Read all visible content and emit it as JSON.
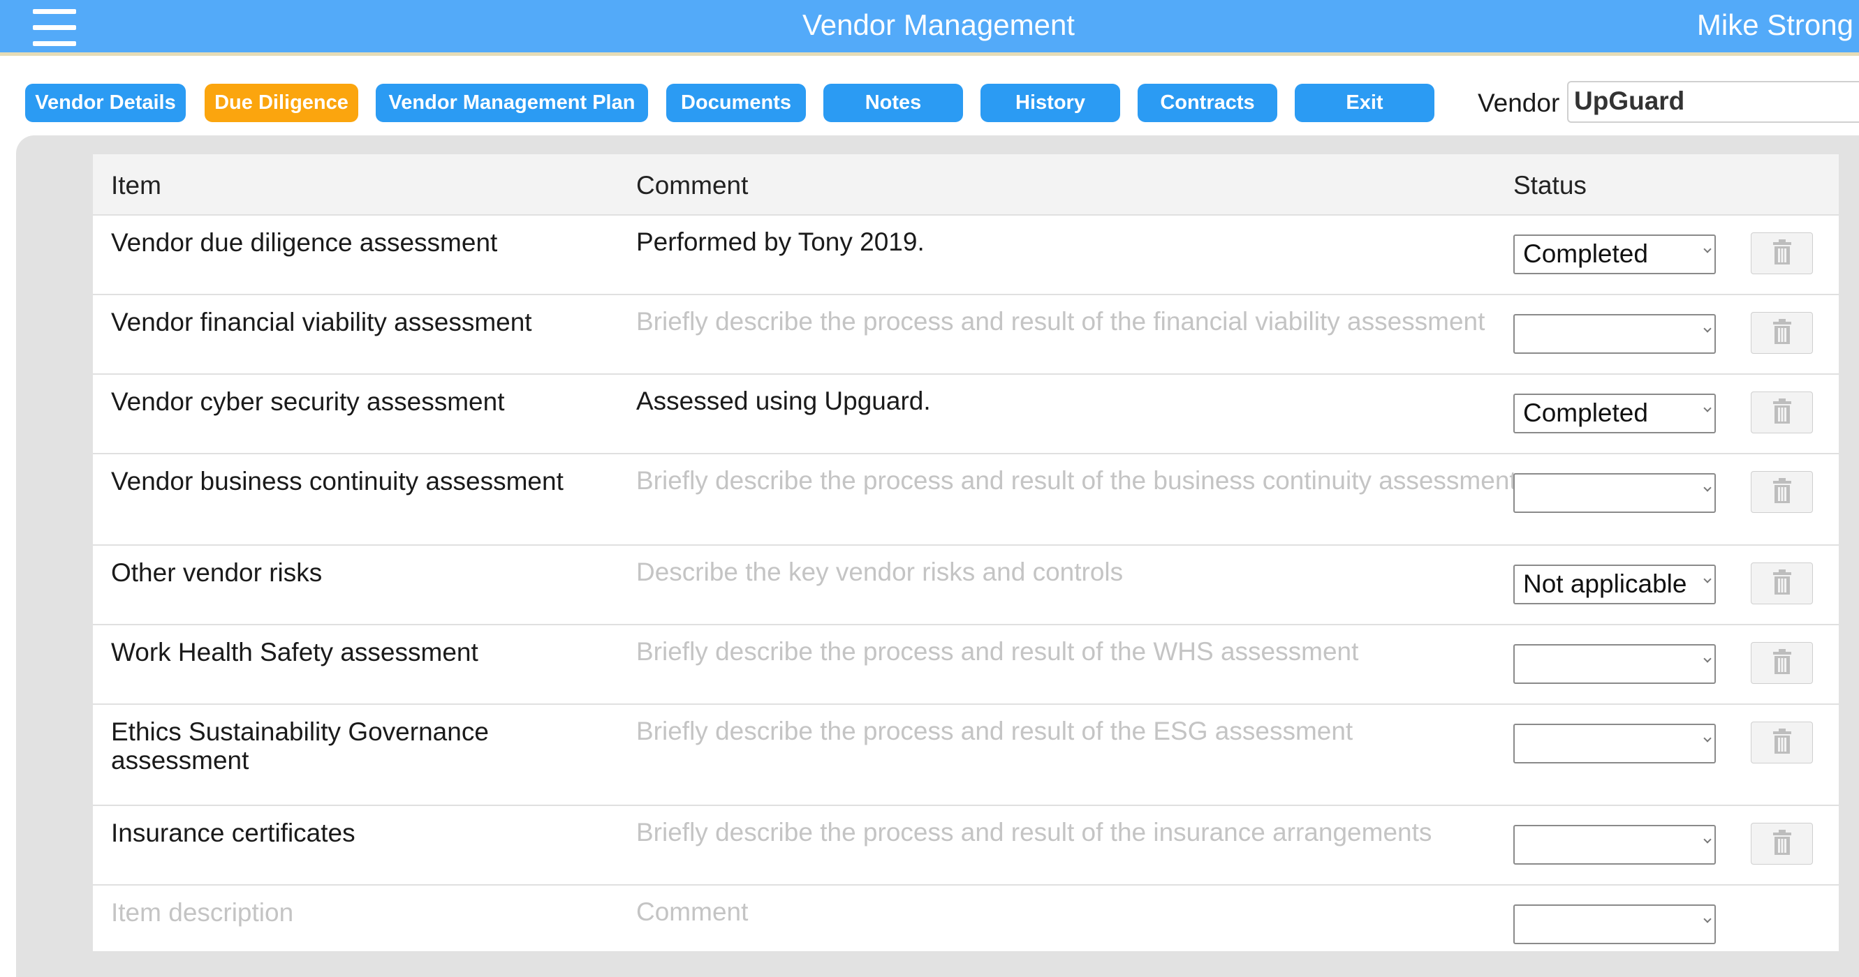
{
  "app": {
    "title": "Vendor Management",
    "user": "Mike Strong"
  },
  "tabs": [
    {
      "label": "Vendor Details",
      "active": false
    },
    {
      "label": "Due Diligence",
      "active": true
    },
    {
      "label": "Vendor Management Plan",
      "active": false
    },
    {
      "label": "Documents",
      "active": false
    },
    {
      "label": "Notes",
      "active": false
    },
    {
      "label": "History",
      "active": false
    },
    {
      "label": "Contracts",
      "active": false
    },
    {
      "label": "Exit",
      "active": false
    }
  ],
  "vendor": {
    "label": "Vendor",
    "value": "UpGuard"
  },
  "grid": {
    "headers": {
      "item": "Item",
      "comment": "Comment",
      "status": "Status"
    },
    "rows": [
      {
        "item": "Vendor due diligence assessment",
        "comment": "Performed by Tony 2019.",
        "comment_placeholder": "",
        "status": "Completed"
      },
      {
        "item": "Vendor financial viability assessment",
        "comment": "",
        "comment_placeholder": "Briefly describe the process and result of the financial viability assessment",
        "status": ""
      },
      {
        "item": "Vendor cyber security assessment",
        "comment": "Assessed using Upguard.",
        "comment_placeholder": "",
        "status": "Completed"
      },
      {
        "item": "Vendor business continuity assessment",
        "comment": "",
        "comment_placeholder": "Briefly describe the process and result of the business continuity assessment",
        "status": ""
      },
      {
        "item": "Other vendor risks",
        "comment": "",
        "comment_placeholder": "Describe the key vendor risks and controls",
        "status": "Not applicable"
      },
      {
        "item": "Work Health Safety assessment",
        "comment": "",
        "comment_placeholder": "Briefly describe the process and result of the WHS assessment",
        "status": ""
      },
      {
        "item": "Ethics Sustainability Governance assessment",
        "comment": "",
        "comment_placeholder": "Briefly describe the process and result of the ESG assessment",
        "status": ""
      },
      {
        "item": "Insurance certificates",
        "comment": "",
        "comment_placeholder": "Briefly describe the process and result of the insurance arrangements",
        "status": ""
      }
    ],
    "new_row": {
      "item_placeholder": "Item description",
      "comment_placeholder": "Comment",
      "status": ""
    }
  },
  "colors": {
    "header_bar": "#53aaf9",
    "tab": "#2b9bf3",
    "tab_active": "#fba50e",
    "panel": "#e2e2e2"
  },
  "icons": {
    "menu": "hamburger-menu-icon",
    "delete": "trash-icon",
    "dropdown": "chevron-down-icon"
  }
}
